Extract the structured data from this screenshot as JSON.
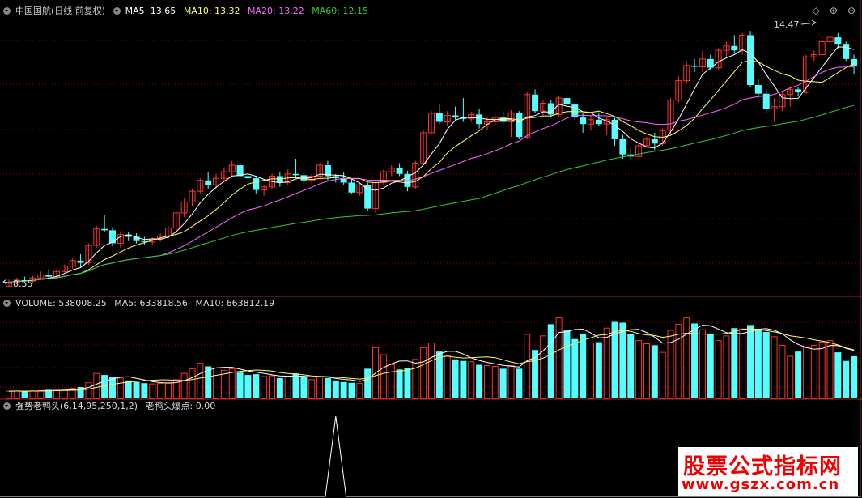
{
  "header": {
    "stock_title": "中国国航(日线 前复权)",
    "ma5_label": "MA5: 13.65",
    "ma10_label": "MA10: 13.32",
    "ma20_label": "MA20: 13.22",
    "ma60_label": "MA60: 12.15"
  },
  "volume_header": {
    "volume_label": "VOLUME: 538008.25",
    "ma5_label": "MA5: 633818.56",
    "ma10_label": "MA10: 663812.19"
  },
  "indicator_header": {
    "name_label": "强势老鸭头(6,14,95,250,1,2)",
    "value_label": "老鸭头爆点: 0.00"
  },
  "annotations": {
    "high_label": "14.47",
    "low_label": "8.55"
  },
  "watermark": {
    "line1": "股票公式指标网",
    "line2": "www.gszx.com.cn"
  },
  "colors": {
    "up": "#ff3232",
    "down": "#54ffff",
    "ma5": "#ffffff",
    "ma10": "#ffff66",
    "ma20": "#ff66ff",
    "ma60": "#33cc33",
    "grid": "#8b0000",
    "border": "#b22222"
  },
  "chart_data": {
    "type": "candlestick",
    "price_range": [
      8.4,
      14.75
    ],
    "candles": [
      {
        "o": 8.56,
        "h": 8.71,
        "l": 8.55,
        "c": 8.65
      },
      {
        "o": 8.65,
        "h": 8.76,
        "l": 8.6,
        "c": 8.7
      },
      {
        "o": 8.7,
        "h": 8.78,
        "l": 8.62,
        "c": 8.68
      },
      {
        "o": 8.68,
        "h": 8.8,
        "l": 8.62,
        "c": 8.75
      },
      {
        "o": 8.75,
        "h": 8.9,
        "l": 8.7,
        "c": 8.82
      },
      {
        "o": 8.82,
        "h": 8.95,
        "l": 8.74,
        "c": 8.78
      },
      {
        "o": 8.78,
        "h": 8.95,
        "l": 8.72,
        "c": 8.9
      },
      {
        "o": 8.9,
        "h": 9.06,
        "l": 8.85,
        "c": 9.02
      },
      {
        "o": 9.02,
        "h": 9.2,
        "l": 8.96,
        "c": 9.15
      },
      {
        "o": 9.15,
        "h": 9.3,
        "l": 9.0,
        "c": 9.1
      },
      {
        "o": 9.1,
        "h": 9.55,
        "l": 9.05,
        "c": 9.5
      },
      {
        "o": 9.5,
        "h": 9.95,
        "l": 9.45,
        "c": 9.88
      },
      {
        "o": 9.88,
        "h": 10.2,
        "l": 9.8,
        "c": 9.85
      },
      {
        "o": 9.85,
        "h": 9.92,
        "l": 9.48,
        "c": 9.55
      },
      {
        "o": 9.55,
        "h": 9.8,
        "l": 9.45,
        "c": 9.75
      },
      {
        "o": 9.75,
        "h": 9.82,
        "l": 9.6,
        "c": 9.7
      },
      {
        "o": 9.7,
        "h": 9.78,
        "l": 9.55,
        "c": 9.6
      },
      {
        "o": 9.6,
        "h": 9.7,
        "l": 9.52,
        "c": 9.58
      },
      {
        "o": 9.58,
        "h": 9.68,
        "l": 9.5,
        "c": 9.64
      },
      {
        "o": 9.64,
        "h": 9.78,
        "l": 9.58,
        "c": 9.72
      },
      {
        "o": 9.72,
        "h": 9.95,
        "l": 9.65,
        "c": 9.9
      },
      {
        "o": 9.9,
        "h": 10.3,
        "l": 9.85,
        "c": 10.25
      },
      {
        "o": 10.25,
        "h": 10.6,
        "l": 10.15,
        "c": 10.5
      },
      {
        "o": 10.5,
        "h": 10.8,
        "l": 10.4,
        "c": 10.75
      },
      {
        "o": 10.75,
        "h": 11.05,
        "l": 10.7,
        "c": 11.0
      },
      {
        "o": 11.0,
        "h": 11.2,
        "l": 10.8,
        "c": 10.9
      },
      {
        "o": 10.9,
        "h": 11.15,
        "l": 10.8,
        "c": 11.05
      },
      {
        "o": 11.05,
        "h": 11.3,
        "l": 10.95,
        "c": 11.2
      },
      {
        "o": 11.2,
        "h": 11.45,
        "l": 11.1,
        "c": 11.35
      },
      {
        "o": 11.35,
        "h": 11.42,
        "l": 11.0,
        "c": 11.1
      },
      {
        "o": 11.1,
        "h": 11.2,
        "l": 10.95,
        "c": 11.05
      },
      {
        "o": 11.05,
        "h": 11.1,
        "l": 10.7,
        "c": 10.78
      },
      {
        "o": 10.78,
        "h": 10.9,
        "l": 10.65,
        "c": 10.85
      },
      {
        "o": 10.85,
        "h": 11.15,
        "l": 10.8,
        "c": 11.1
      },
      {
        "o": 11.1,
        "h": 11.2,
        "l": 10.85,
        "c": 10.95
      },
      {
        "o": 10.95,
        "h": 11.25,
        "l": 10.9,
        "c": 11.15
      },
      {
        "o": 11.15,
        "h": 11.5,
        "l": 11.05,
        "c": 11.12
      },
      {
        "o": 11.12,
        "h": 11.2,
        "l": 10.9,
        "c": 11.0
      },
      {
        "o": 11.0,
        "h": 11.15,
        "l": 10.9,
        "c": 11.1
      },
      {
        "o": 11.1,
        "h": 11.4,
        "l": 11.05,
        "c": 11.35
      },
      {
        "o": 11.35,
        "h": 11.45,
        "l": 11.0,
        "c": 11.1
      },
      {
        "o": 11.1,
        "h": 11.15,
        "l": 10.95,
        "c": 11.05
      },
      {
        "o": 11.05,
        "h": 11.2,
        "l": 10.9,
        "c": 10.95
      },
      {
        "o": 10.95,
        "h": 11.05,
        "l": 10.7,
        "c": 10.72
      },
      {
        "o": 10.72,
        "h": 10.95,
        "l": 10.65,
        "c": 10.9
      },
      {
        "o": 10.9,
        "h": 10.95,
        "l": 10.3,
        "c": 10.35
      },
      {
        "o": 10.35,
        "h": 11.0,
        "l": 10.25,
        "c": 10.95
      },
      {
        "o": 10.95,
        "h": 11.25,
        "l": 10.9,
        "c": 11.2
      },
      {
        "o": 11.2,
        "h": 11.35,
        "l": 11.1,
        "c": 11.28
      },
      {
        "o": 11.28,
        "h": 11.4,
        "l": 11.1,
        "c": 11.15
      },
      {
        "o": 11.15,
        "h": 11.22,
        "l": 10.75,
        "c": 10.85
      },
      {
        "o": 10.85,
        "h": 11.45,
        "l": 10.8,
        "c": 11.4
      },
      {
        "o": 11.4,
        "h": 12.15,
        "l": 11.35,
        "c": 12.1
      },
      {
        "o": 12.1,
        "h": 12.6,
        "l": 12.05,
        "c": 12.55
      },
      {
        "o": 12.55,
        "h": 12.75,
        "l": 12.3,
        "c": 12.35
      },
      {
        "o": 12.35,
        "h": 12.6,
        "l": 12.25,
        "c": 12.5
      },
      {
        "o": 12.5,
        "h": 12.7,
        "l": 12.4,
        "c": 12.45
      },
      {
        "o": 12.45,
        "h": 12.9,
        "l": 12.35,
        "c": 12.42
      },
      {
        "o": 12.42,
        "h": 12.58,
        "l": 12.35,
        "c": 12.52
      },
      {
        "o": 12.52,
        "h": 12.65,
        "l": 12.2,
        "c": 12.3
      },
      {
        "o": 12.3,
        "h": 12.45,
        "l": 12.15,
        "c": 12.35
      },
      {
        "o": 12.35,
        "h": 12.5,
        "l": 12.25,
        "c": 12.45
      },
      {
        "o": 12.45,
        "h": 12.6,
        "l": 12.3,
        "c": 12.35
      },
      {
        "o": 12.35,
        "h": 12.62,
        "l": 12.0,
        "c": 12.55
      },
      {
        "o": 12.55,
        "h": 12.6,
        "l": 11.95,
        "c": 12.0
      },
      {
        "o": 12.0,
        "h": 13.05,
        "l": 11.95,
        "c": 12.98
      },
      {
        "o": 12.98,
        "h": 13.1,
        "l": 12.55,
        "c": 12.6
      },
      {
        "o": 12.6,
        "h": 12.85,
        "l": 12.5,
        "c": 12.78
      },
      {
        "o": 12.78,
        "h": 12.85,
        "l": 12.45,
        "c": 12.52
      },
      {
        "o": 12.52,
        "h": 12.95,
        "l": 12.45,
        "c": 12.9
      },
      {
        "o": 12.9,
        "h": 13.15,
        "l": 12.7,
        "c": 12.75
      },
      {
        "o": 12.75,
        "h": 12.8,
        "l": 12.4,
        "c": 12.45
      },
      {
        "o": 12.45,
        "h": 12.55,
        "l": 12.1,
        "c": 12.3
      },
      {
        "o": 12.3,
        "h": 12.5,
        "l": 12.15,
        "c": 12.4
      },
      {
        "o": 12.4,
        "h": 12.55,
        "l": 12.25,
        "c": 12.3
      },
      {
        "o": 12.3,
        "h": 12.45,
        "l": 12.05,
        "c": 12.4
      },
      {
        "o": 12.4,
        "h": 12.45,
        "l": 11.8,
        "c": 11.95
      },
      {
        "o": 11.95,
        "h": 12.05,
        "l": 11.5,
        "c": 11.6
      },
      {
        "o": 11.6,
        "h": 11.75,
        "l": 11.5,
        "c": 11.55
      },
      {
        "o": 11.55,
        "h": 11.85,
        "l": 11.5,
        "c": 11.8
      },
      {
        "o": 11.8,
        "h": 12.0,
        "l": 11.75,
        "c": 11.95
      },
      {
        "o": 11.95,
        "h": 12.1,
        "l": 11.7,
        "c": 11.85
      },
      {
        "o": 11.85,
        "h": 12.2,
        "l": 11.8,
        "c": 12.15
      },
      {
        "o": 12.15,
        "h": 12.9,
        "l": 12.05,
        "c": 12.85
      },
      {
        "o": 12.85,
        "h": 13.4,
        "l": 12.8,
        "c": 13.3
      },
      {
        "o": 13.3,
        "h": 13.75,
        "l": 13.25,
        "c": 13.65
      },
      {
        "o": 13.65,
        "h": 13.8,
        "l": 13.5,
        "c": 13.62
      },
      {
        "o": 13.62,
        "h": 14.0,
        "l": 13.5,
        "c": 13.8
      },
      {
        "o": 13.8,
        "h": 13.9,
        "l": 13.55,
        "c": 13.6
      },
      {
        "o": 13.6,
        "h": 14.05,
        "l": 13.55,
        "c": 14.0
      },
      {
        "o": 14.0,
        "h": 14.2,
        "l": 13.85,
        "c": 14.1
      },
      {
        "o": 14.1,
        "h": 14.35,
        "l": 13.95,
        "c": 14.0
      },
      {
        "o": 14.0,
        "h": 14.4,
        "l": 13.9,
        "c": 14.35
      },
      {
        "o": 14.35,
        "h": 14.45,
        "l": 13.15,
        "c": 13.2
      },
      {
        "o": 13.2,
        "h": 13.35,
        "l": 12.9,
        "c": 13.0
      },
      {
        "o": 13.0,
        "h": 13.1,
        "l": 12.55,
        "c": 12.65
      },
      {
        "o": 12.65,
        "h": 12.9,
        "l": 12.35,
        "c": 12.7
      },
      {
        "o": 12.7,
        "h": 13.05,
        "l": 12.6,
        "c": 12.98
      },
      {
        "o": 12.98,
        "h": 13.15,
        "l": 12.7,
        "c": 13.1
      },
      {
        "o": 13.1,
        "h": 13.15,
        "l": 12.95,
        "c": 13.03
      },
      {
        "o": 13.03,
        "h": 13.9,
        "l": 13.0,
        "c": 13.85
      },
      {
        "o": 13.85,
        "h": 14.0,
        "l": 13.75,
        "c": 13.9
      },
      {
        "o": 13.9,
        "h": 14.3,
        "l": 13.8,
        "c": 14.2
      },
      {
        "o": 14.2,
        "h": 14.47,
        "l": 14.1,
        "c": 14.3
      },
      {
        "o": 14.3,
        "h": 14.4,
        "l": 14.05,
        "c": 14.15
      },
      {
        "o": 14.15,
        "h": 14.2,
        "l": 13.75,
        "c": 13.8
      },
      {
        "o": 13.8,
        "h": 13.9,
        "l": 13.45,
        "c": 13.65
      }
    ],
    "ma_periods": {
      "MA5": 5,
      "MA10": 10,
      "MA20": 20,
      "MA60": 60
    },
    "volume_range": [
      0,
      1120000
    ],
    "volume": [
      92000,
      95000,
      90000,
      96000,
      100000,
      110000,
      105000,
      115000,
      130000,
      145000,
      200000,
      320000,
      300000,
      280000,
      260000,
      230000,
      210000,
      195000,
      185000,
      190000,
      200000,
      240000,
      320000,
      380000,
      450000,
      410000,
      390000,
      360000,
      380000,
      330000,
      300000,
      310000,
      280000,
      290000,
      260000,
      280000,
      320000,
      270000,
      240000,
      280000,
      260000,
      230000,
      210000,
      200000,
      190000,
      380000,
      650000,
      560000,
      430000,
      370000,
      390000,
      500000,
      650000,
      710000,
      600000,
      550000,
      500000,
      480000,
      470000,
      430000,
      420000,
      410000,
      380000,
      420000,
      380000,
      820000,
      620000,
      800000,
      950000,
      1030000,
      870000,
      760000,
      820000,
      710000,
      720000,
      900000,
      980000,
      970000,
      830000,
      740000,
      700000,
      680000,
      590000,
      870000,
      950000,
      1030000,
      960000,
      880000,
      830000,
      740000,
      800000,
      900000,
      890000,
      940000,
      890000,
      850000,
      790000,
      680000,
      540000,
      600000,
      650000,
      680000,
      720000,
      740000,
      590000,
      480000,
      540000
    ],
    "indicator": {
      "name": "强势老鸭头",
      "params": [
        6,
        14,
        95,
        250,
        1,
        2
      ],
      "value": 0.0,
      "signal_bar": 41,
      "range": [
        0,
        1
      ]
    }
  }
}
